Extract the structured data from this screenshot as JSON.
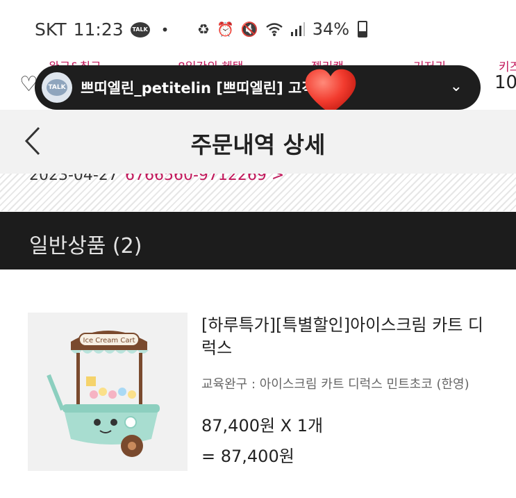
{
  "status_bar": {
    "carrier": "SKT",
    "time": "11:23",
    "talk_badge": "TALK",
    "dot": "•",
    "battery": "34%"
  },
  "background_nav": {
    "tabs": [
      "완구&취구",
      "8일간의 혜택",
      "젤리캣",
      "기저귀",
      "키즈"
    ],
    "count": "10"
  },
  "kakao_popup": {
    "avatar_badge": "TALK",
    "message": "쁘띠엘린_petitelin  [쁘띠엘린]  고객님…",
    "sticker": "heart"
  },
  "header": {
    "title": "주문내역 상세"
  },
  "order": {
    "date": "2023-04-27",
    "number": "6766560-9712269 >"
  },
  "section": {
    "title": "일반상품 (2)"
  },
  "product": {
    "image_label": "Ice Cream Cart",
    "title": "[하루특가][특별할인]아이스크림 카트 디럭스",
    "option": "교육완구 : 아이스크림 카트 디럭스 민트초코 (한영)",
    "price_line": "87,400원 X 1개",
    "total_line": "= 87,400원"
  },
  "colors": {
    "accent": "#c2185b",
    "header_bg": "#f2f2f2",
    "section_bg": "#1c1c1c"
  }
}
